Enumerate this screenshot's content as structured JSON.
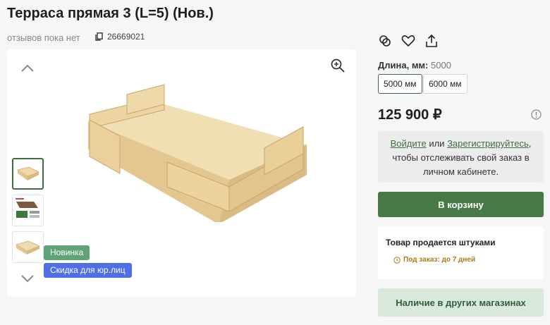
{
  "product": {
    "title": "Терраса прямая 3 (L=5) (Нов.)",
    "reviews_text": "отзывов пока нет",
    "sku": "26669021"
  },
  "gallery": {
    "badges": [
      {
        "label": "Новинка",
        "color": "#5fa377"
      },
      {
        "label": "Скидка для юр.лиц",
        "color": "#4e6fe6"
      }
    ],
    "thumb_count": 3,
    "active_thumb": 0
  },
  "options": {
    "label": "Длина, мм:",
    "value": "5000",
    "items": [
      {
        "label": "5000 мм",
        "selected": true
      },
      {
        "label": "6000 мм",
        "selected": false
      }
    ]
  },
  "price": "125 900 ₽",
  "login": {
    "login_link": "Войдите",
    "or": "или",
    "register_link": "Зарегистрируйтесь",
    "rest": ", чтобы отслеживать свой заказ в личном кабинете."
  },
  "cart_button": "В корзину",
  "sale": {
    "title": "Товар продается штуками",
    "order": "Под заказ: до 7 дней"
  },
  "stores_button": "Наличие в других магазинах",
  "colors": {
    "accent": "#487a48",
    "accent_light": "#d9eadc",
    "order_text": "#b07818"
  }
}
